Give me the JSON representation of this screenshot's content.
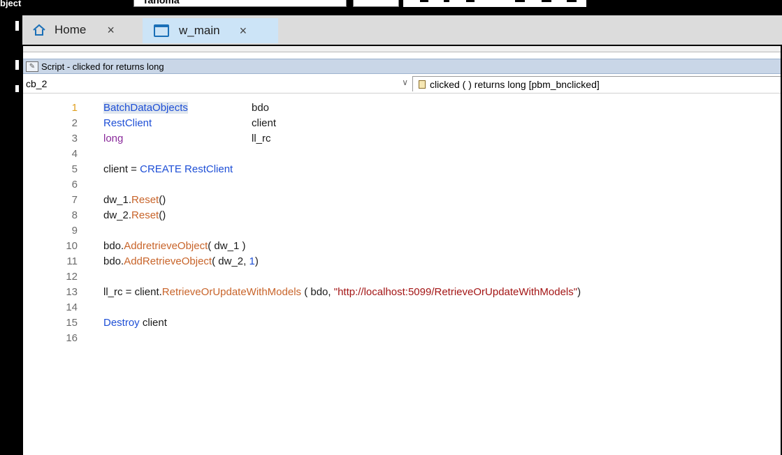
{
  "toolbar": {
    "label": "bject",
    "font_name": "Tahoma"
  },
  "tabs": [
    {
      "label": "Home",
      "close": "×"
    },
    {
      "label": "w_main",
      "close": "×"
    }
  ],
  "panel": {
    "title": "Script - clicked for  returns long",
    "object_select": "cb_2",
    "event_select": "clicked ( )  returns long [pbm_bnclicked]"
  },
  "code_lines": [
    {
      "n": "1"
    },
    {
      "n": "2"
    },
    {
      "n": "3"
    },
    {
      "n": "4"
    },
    {
      "n": "5"
    },
    {
      "n": "6"
    },
    {
      "n": "7"
    },
    {
      "n": "8"
    },
    {
      "n": "9"
    },
    {
      "n": "10"
    },
    {
      "n": "11"
    },
    {
      "n": "12"
    },
    {
      "n": "13"
    },
    {
      "n": "14"
    },
    {
      "n": "15"
    },
    {
      "n": "16"
    }
  ],
  "code": {
    "l1_type": "BatchDataObjects",
    "l1_var": "bdo",
    "l2_type": "RestClient",
    "l2_var": "client",
    "l3_type": "long",
    "l3_var": "ll_rc",
    "l5_a": "client = ",
    "l5_kw": "CREATE",
    "l5_b": " ",
    "l5_type": "RestClient",
    "l7_a": "dw_1.",
    "l7_fn": "Reset",
    "l7_b": "()",
    "l8_a": "dw_2.",
    "l8_fn": "Reset",
    "l8_b": "()",
    "l10_a": "bdo.",
    "l10_fn": "AddretrieveObject",
    "l10_b": "( dw_1 )",
    "l11_a": "bdo.",
    "l11_fn": "AddRetrieveObject",
    "l11_b": "( dw_2, ",
    "l11_num": "1",
    "l11_c": ")",
    "l13_a": "ll_rc = client.",
    "l13_fn": "RetrieveOrUpdateWithModels",
    "l13_b": " ( bdo, ",
    "l13_str": "\"http://localhost:5099/RetrieveOrUpdateWithModels\"",
    "l13_c": ")",
    "l15_kw": "Destroy",
    "l15_b": " client"
  },
  "colors": {
    "type": "#1e4fd6",
    "keyword": "#1e4fd6",
    "long": "#8a2b9b",
    "function": "#c8642a",
    "string": "#a31515",
    "current_line_number": "#e0a020",
    "tab_active": "#cce4f7",
    "title_bar": "#c9d6e7"
  }
}
